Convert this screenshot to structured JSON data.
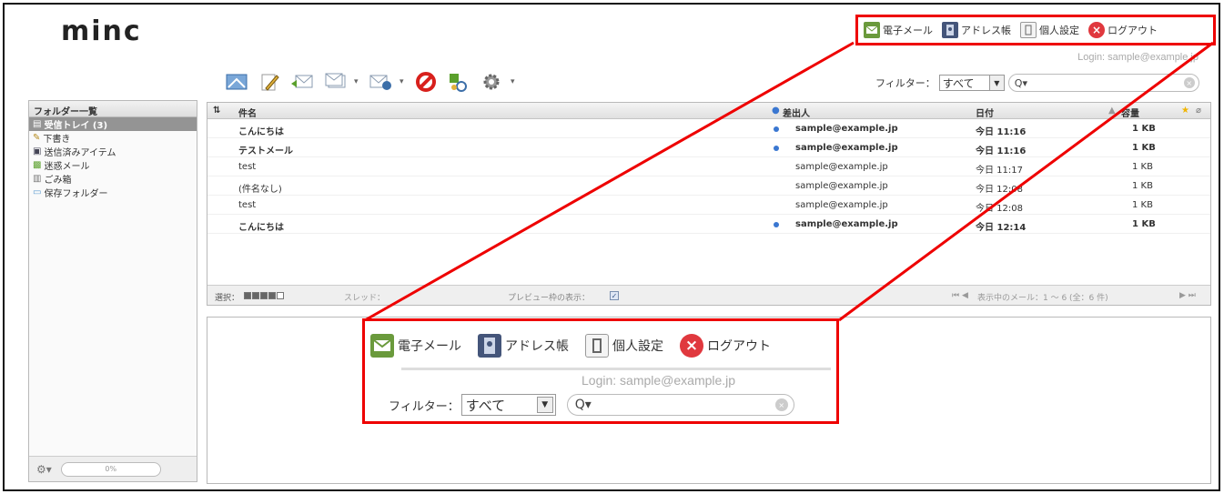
{
  "logo": "minc",
  "menu": {
    "mail": "電子メール",
    "address": "アドレス帳",
    "settings": "個人設定",
    "logout": "ログアウト"
  },
  "login": "Login: sample@example.jp",
  "filter": {
    "label": "フィルター：",
    "value": "すべて",
    "search_placeholder": "Q▾"
  },
  "sidebar": {
    "title": "フォルダー一覧",
    "folders": [
      {
        "label": "受信トレイ (3)",
        "icon": "inbox-icon"
      },
      {
        "label": "下書き",
        "icon": "pencil-icon"
      },
      {
        "label": "送信済みアイテム",
        "icon": "sent-icon"
      },
      {
        "label": "迷惑メール",
        "icon": "junk-icon"
      },
      {
        "label": "ごみ箱",
        "icon": "trash-icon"
      },
      {
        "label": "保存フォルダー",
        "icon": "folder-icon"
      }
    ],
    "quota": "0%"
  },
  "list": {
    "columns": {
      "subject": "件名",
      "from": "差出人",
      "date": "日付",
      "size": "容量"
    },
    "rows": [
      {
        "subject": "こんにちは",
        "from": "sample@example.jp",
        "date": "今日 11:16",
        "size": "1 KB",
        "unread": true
      },
      {
        "subject": "テストメール",
        "from": "sample@example.jp",
        "date": "今日 11:16",
        "size": "1 KB",
        "unread": true
      },
      {
        "subject": "test",
        "from": "sample@example.jp",
        "date": "今日 11:17",
        "size": "1 KB",
        "unread": false
      },
      {
        "subject": "(件名なし)",
        "from": "sample@example.jp",
        "date": "今日 12:08",
        "size": "1 KB",
        "unread": false
      },
      {
        "subject": "test",
        "from": "sample@example.jp",
        "date": "今日 12:08",
        "size": "1 KB",
        "unread": false
      },
      {
        "subject": "こんにちは",
        "from": "sample@example.jp",
        "date": "今日 12:14",
        "size": "1 KB",
        "unread": true
      }
    ],
    "footer": {
      "select": "選択：",
      "thread": "スレッド：",
      "preview": "プレビュー枠の表示：",
      "count": "表示中のメール：1 ～ 6 (全：6 件)"
    }
  },
  "colors": {
    "highlight": "#e00000",
    "unread_dot": "#3a77d1",
    "selected_folder": "#949494"
  }
}
